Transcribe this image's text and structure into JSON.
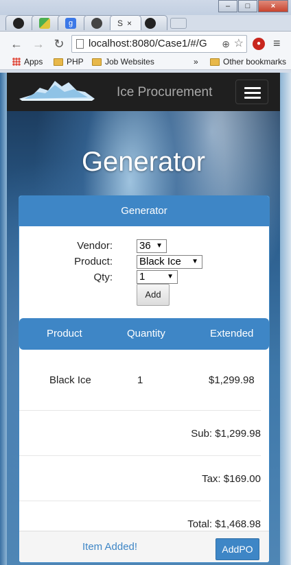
{
  "browser": {
    "tabs": [
      {
        "icon": "github-icon",
        "title": ""
      },
      {
        "icon": "maps-icon",
        "title": ""
      },
      {
        "icon": "google-icon",
        "title": ""
      },
      {
        "icon": "avatar-icon",
        "title": ""
      },
      {
        "icon": "page-icon",
        "title": "S",
        "active": true
      },
      {
        "icon": "github-icon",
        "title": ""
      }
    ],
    "url": "localhost:8080/Case1/#/G",
    "bookmarks": {
      "apps": "Apps",
      "php": "PHP",
      "jobs": "Job Websites",
      "more": "»",
      "other": "Other bookmarks"
    }
  },
  "navbar": {
    "brand": "Ice Procurement"
  },
  "page": {
    "title": "Generator"
  },
  "panel": {
    "heading": "Generator",
    "form": {
      "vendor_label": "Vendor:",
      "vendor_value": "36",
      "product_label": "Product:",
      "product_value": "Black Ice",
      "qty_label": "Qty:",
      "qty_value": "1",
      "add_label": "Add"
    },
    "table": {
      "headers": [
        "Product",
        "Quantity",
        "Extended"
      ],
      "rows": [
        {
          "product": "Black Ice",
          "quantity": "1",
          "extended": "$1,299.98"
        }
      ],
      "sub": "Sub: $1,299.98",
      "tax": "Tax: $169.00",
      "total": "Total: $1,468.98"
    },
    "footer": {
      "status": "Item Added!",
      "addpo_label": "AddPO"
    }
  },
  "colors": {
    "accent": "#3e86c6",
    "navbar": "#1f1f1f"
  }
}
